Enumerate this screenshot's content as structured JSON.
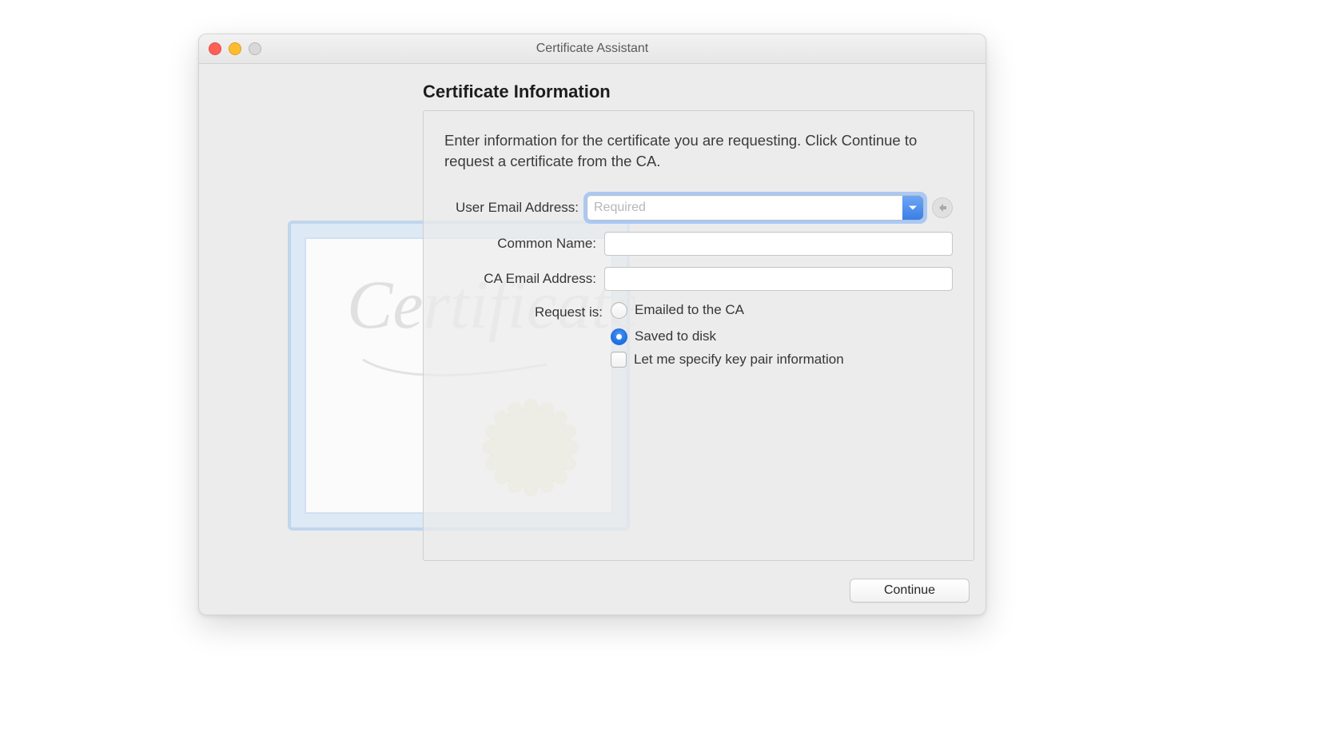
{
  "window": {
    "title": "Certificate Assistant"
  },
  "heading": "Certificate Information",
  "instructions": "Enter information for the certificate you are requesting. Click Continue to request a certificate from the CA.",
  "form": {
    "user_email": {
      "label": "User Email Address:",
      "placeholder": "Required",
      "value": ""
    },
    "common_name": {
      "label": "Common Name:",
      "value": ""
    },
    "ca_email": {
      "label": "CA Email Address:",
      "value": ""
    },
    "request_label": "Request is:",
    "option_emailed": "Emailed to the CA",
    "option_saved": "Saved to disk",
    "selected_option": "saved",
    "keypair_label": "Let me specify key pair information",
    "keypair_checked": false
  },
  "buttons": {
    "continue": "Continue"
  }
}
